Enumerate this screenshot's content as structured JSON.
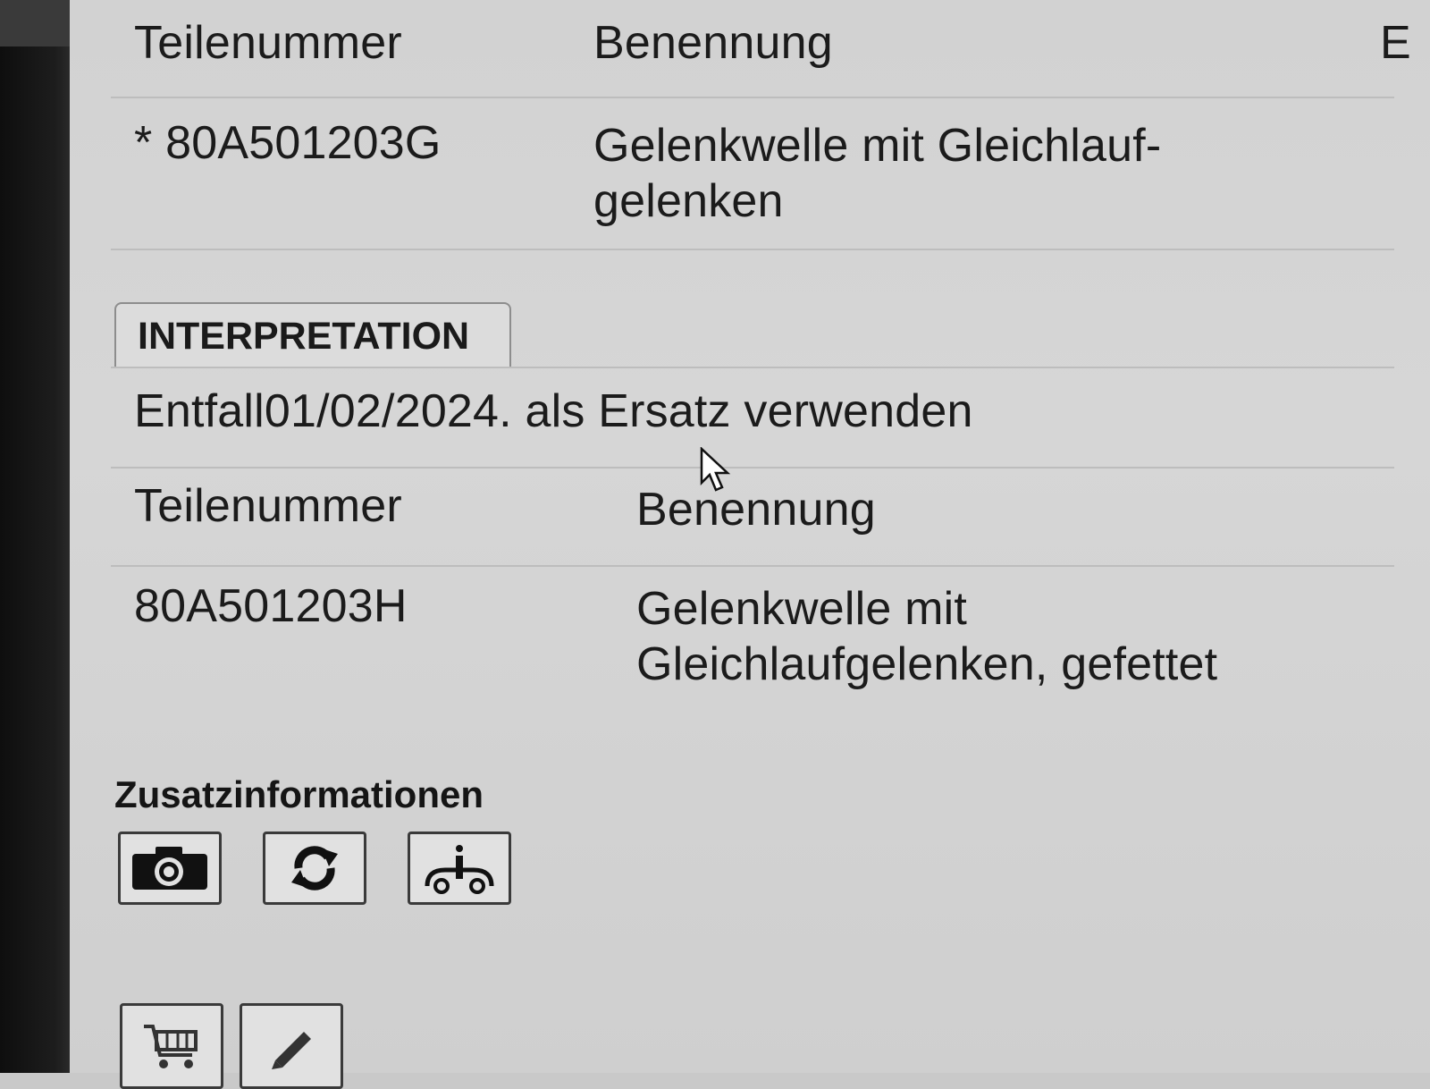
{
  "table1": {
    "header": {
      "part_no": "Teilenummer",
      "name": "Benennung",
      "cut_col": "E"
    },
    "row": {
      "part_no": "* 80A501203G",
      "name": "Gelenkwelle mit Gleichlauf-gelenken"
    }
  },
  "interpretation": {
    "tab_label": "INTERPRETATION",
    "text": "Entfall01/02/2024. als Ersatz verwenden"
  },
  "table2": {
    "header": {
      "part_no": "Teilenummer",
      "name": "Benennung"
    },
    "row": {
      "part_no": "80A501203H",
      "name": "Gelenkwelle mit Gleichlaufgelenken, gefettet"
    }
  },
  "additional_info": {
    "heading": "Zusatzinformationen",
    "buttons": [
      {
        "icon": "camera-icon"
      },
      {
        "icon": "refresh-icon"
      },
      {
        "icon": "vehicle-info-icon"
      }
    ]
  },
  "bottom_actions": [
    {
      "icon": "cart-icon"
    },
    {
      "icon": "pencil-icon"
    }
  ]
}
